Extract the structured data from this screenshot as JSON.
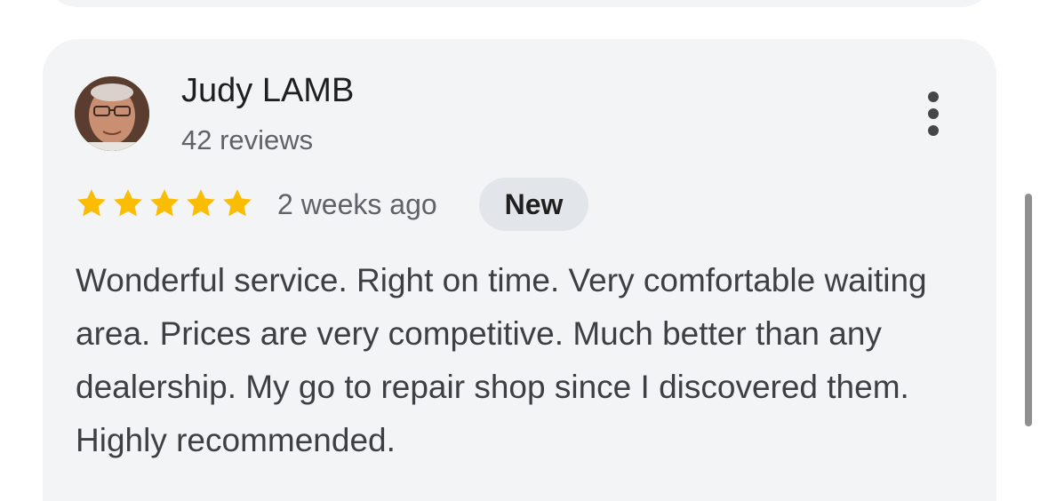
{
  "review": {
    "reviewer_name": "Judy LAMB",
    "review_count": "42 reviews",
    "rating": 5,
    "rating_max": 5,
    "time": "2 weeks ago",
    "badge": "New",
    "text": "Wonderful service. Right on time. Very comfortable waiting area. Prices are very competitive. Much better than any dealership. My go to repair shop since I discovered them. Highly recommended."
  },
  "icons": {
    "more": "more-vert-icon",
    "star": "star-icon"
  },
  "colors": {
    "card_background": "#f3f4f6",
    "star": "#fbbc04",
    "badge_background": "#e2e5e9"
  }
}
